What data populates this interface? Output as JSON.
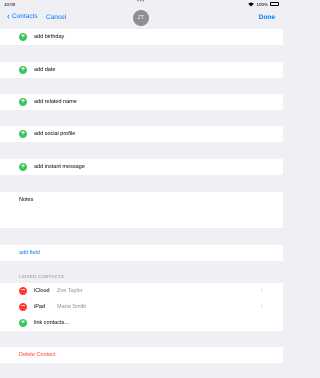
{
  "status": {
    "time": "10:00",
    "dots": "•••",
    "battery": "100%"
  },
  "nav": {
    "back_label": "Contacts",
    "cancel_label": "Cancel",
    "avatar_initials": "ZT",
    "done_label": "Done"
  },
  "rows": {
    "add_birthday": "add birthday",
    "add_date": "add date",
    "add_related": "add related name",
    "add_social": "add social profile",
    "add_im": "add instant message",
    "notes": "Notes",
    "add_field": "add field"
  },
  "linked": {
    "header": "LINKED CONTACTS",
    "items": [
      {
        "source": "iCloud",
        "name": "Zoe Taylor"
      },
      {
        "source": "iPad",
        "name": "Maria Smith"
      }
    ],
    "link_label": "link contacts..."
  },
  "delete_label": "Delete Contact"
}
